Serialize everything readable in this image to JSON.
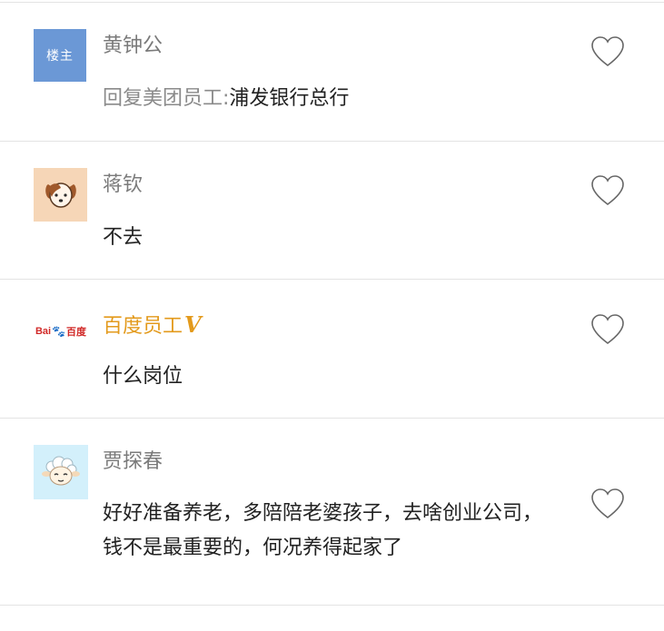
{
  "comments": [
    {
      "avatar": {
        "type": "badge",
        "label": "楼主",
        "color": "#6b98d6",
        "icon": "owner-badge"
      },
      "author": "黄钟公",
      "reply_prefix": "回复美团员工:",
      "text": "浦发银行总行",
      "like_icon": "heart-outline-icon"
    },
    {
      "avatar": {
        "type": "icon",
        "icon": "dog-avatar",
        "bg": "#f6d6b7"
      },
      "author": "蒋钦",
      "text": "不去",
      "like_icon": "heart-outline-icon"
    },
    {
      "avatar": {
        "type": "logo",
        "brand": "Bai",
        "brand2": "百度",
        "icon": "baidu-logo"
      },
      "author": "百度员工",
      "verified_mark": "V",
      "author_color": "#e39a1c",
      "text": "什么岗位",
      "like_icon": "heart-outline-icon"
    },
    {
      "avatar": {
        "type": "icon",
        "icon": "sheep-avatar",
        "bg": "#d3f0fb"
      },
      "author": "贾探春",
      "text": "好好准备养老，多陪陪老婆孩子，去啥创业公司，钱不是最重要的，何况养得起家了",
      "like_icon": "heart-outline-icon"
    }
  ]
}
